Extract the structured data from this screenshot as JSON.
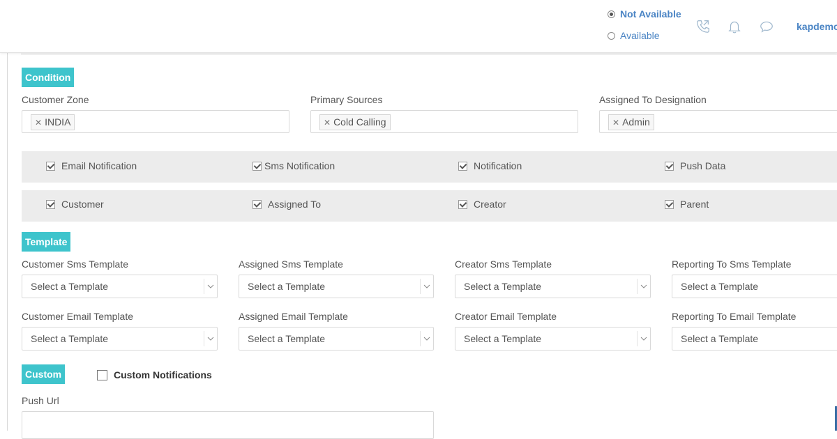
{
  "header": {
    "status_not_available": "Not Available",
    "status_available": "Available",
    "username": "kapdemo"
  },
  "condition": {
    "section_label": "Condition",
    "customer_zone_label": "Customer Zone",
    "customer_zone_tag": "INDIA",
    "primary_sources_label": "Primary Sources",
    "primary_sources_tag": "Cold Calling",
    "assigned_designation_label": "Assigned To Designation",
    "assigned_designation_tag": "Admin"
  },
  "notify_channels": [
    {
      "label": "Email Notification",
      "checked": true
    },
    {
      "label": "Sms Notification",
      "checked": true
    },
    {
      "label": "Notification",
      "checked": true
    },
    {
      "label": "Push Data",
      "checked": true
    }
  ],
  "notify_recipients": [
    {
      "label": "Customer",
      "checked": true
    },
    {
      "label": "Assigned To",
      "checked": true
    },
    {
      "label": "Creator",
      "checked": true
    },
    {
      "label": "Parent",
      "checked": true
    }
  ],
  "template": {
    "section_label": "Template",
    "sms_fields": [
      {
        "label": "Customer Sms Template",
        "value": "Select a Template"
      },
      {
        "label": "Assigned Sms Template",
        "value": "Select a Template"
      },
      {
        "label": "Creator Sms Template",
        "value": "Select a Template"
      },
      {
        "label": "Reporting To Sms Template",
        "value": "Select a Template"
      }
    ],
    "email_fields": [
      {
        "label": "Customer Email Template",
        "value": "Select a Template"
      },
      {
        "label": "Assigned Email Template",
        "value": "Select a Template"
      },
      {
        "label": "Creator Email Template",
        "value": "Select a Template"
      },
      {
        "label": "Reporting To Email Template",
        "value": "Select a Template"
      }
    ]
  },
  "custom": {
    "section_label": "Custom",
    "custom_notifications_label": "Custom Notifications",
    "push_url_label": "Push Url",
    "push_url_value": ""
  },
  "colors": {
    "accent": "#3ec4cc",
    "link": "#4a84c4",
    "band": "#ececec"
  }
}
